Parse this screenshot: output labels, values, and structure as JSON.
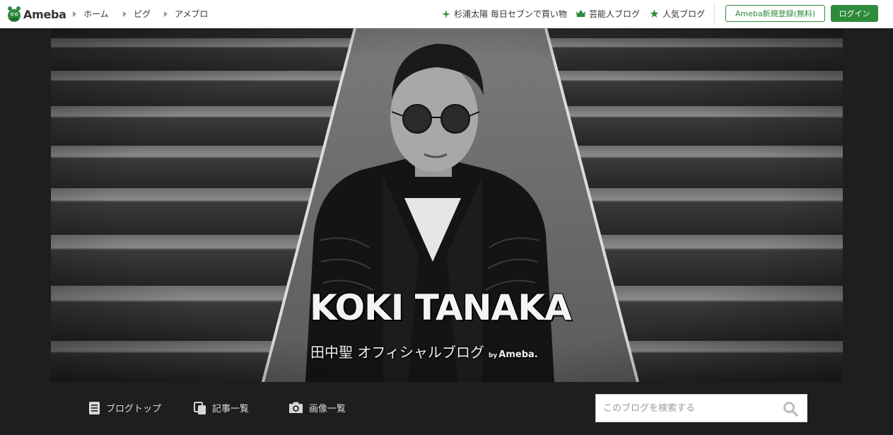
{
  "topbar": {
    "logo_text": "Ameba",
    "nav": [
      {
        "label": "ホーム"
      },
      {
        "label": "ピグ"
      },
      {
        "label": "アメブロ"
      }
    ],
    "right_links": [
      {
        "label": "杉浦太陽 毎日セブンで買い物",
        "icon": "sparkle-icon"
      },
      {
        "label": "芸能人ブログ",
        "icon": "crown-icon"
      },
      {
        "label": "人気ブログ",
        "icon": "star-icon"
      }
    ],
    "register_label": "Ameba新規登録(無料)",
    "login_label": "ログイン"
  },
  "hero": {
    "title": "KOKI TANAKA",
    "subtitle": "田中聖 オフィシャルブログ",
    "by": "by",
    "ameba": "Ameba."
  },
  "subnav": {
    "items": [
      {
        "label": "ブログトップ",
        "icon": "document-icon"
      },
      {
        "label": "記事一覧",
        "icon": "copy-icon"
      },
      {
        "label": "画像一覧",
        "icon": "camera-icon"
      }
    ],
    "search_placeholder": "このブログを検索する"
  },
  "colors": {
    "brand_green": "#2e8b3c",
    "dark_bg": "#1e1e1e"
  }
}
